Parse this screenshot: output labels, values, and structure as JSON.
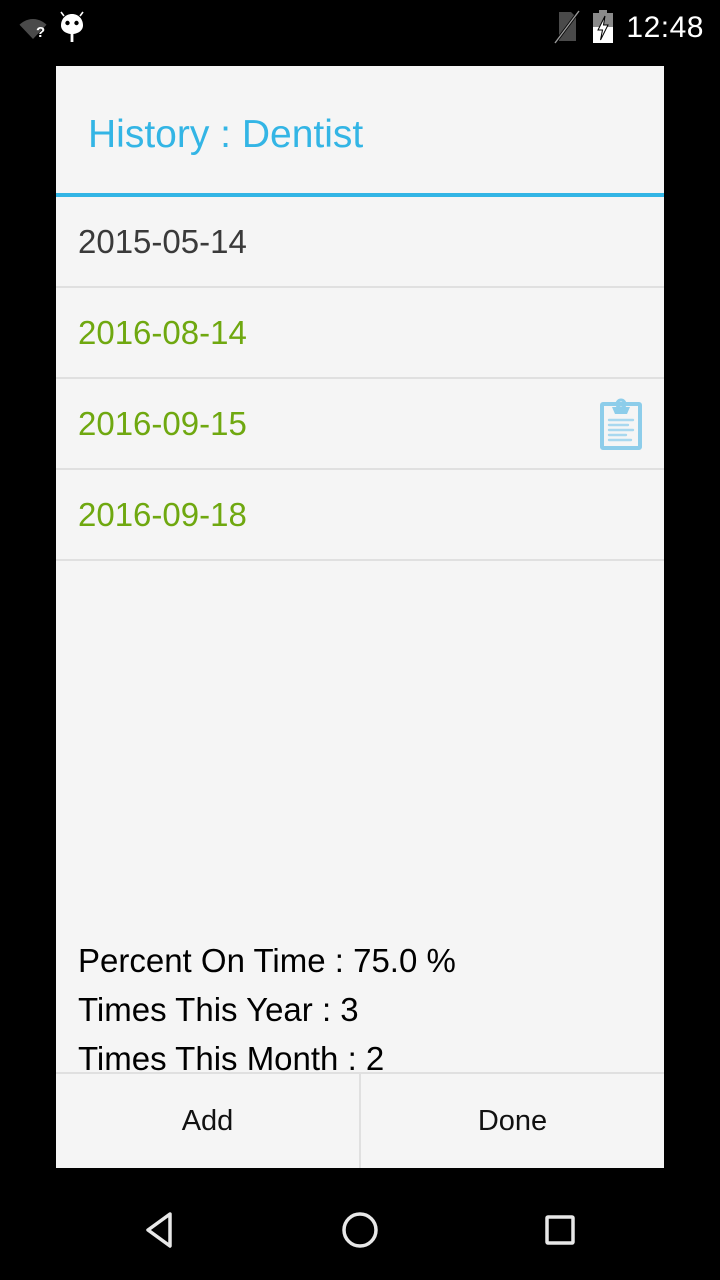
{
  "status_bar": {
    "wifi_icon": "wifi-question-icon",
    "android_icon": "android-head-icon",
    "sim_icon": "no-sim-card-icon",
    "battery_icon": "battery-charging-icon",
    "clock": "12:48"
  },
  "dialog": {
    "title": "History : Dentist",
    "accent_color": "#33b5e5",
    "ontime_color": "#6fa810",
    "late_color": "#3a3a3a",
    "background_color": "#f5f5f5",
    "history": [
      {
        "date": "2015-05-14",
        "state": "late",
        "has_note": false
      },
      {
        "date": "2016-08-14",
        "state": "ontime",
        "has_note": false
      },
      {
        "date": "2016-09-15",
        "state": "ontime",
        "has_note": true,
        "note_icon": "clipboard-notes-icon"
      },
      {
        "date": "2016-09-18",
        "state": "ontime",
        "has_note": false
      }
    ],
    "stats": [
      "Percent On Time : 75.0 %",
      "Times This Year : 3",
      "Times This Month : 2"
    ],
    "buttons": {
      "add_label": "Add",
      "done_label": "Done"
    }
  },
  "nav_bar": {
    "back_icon": "back-triangle-icon",
    "home_icon": "home-circle-icon",
    "recents_icon": "recents-square-icon"
  }
}
